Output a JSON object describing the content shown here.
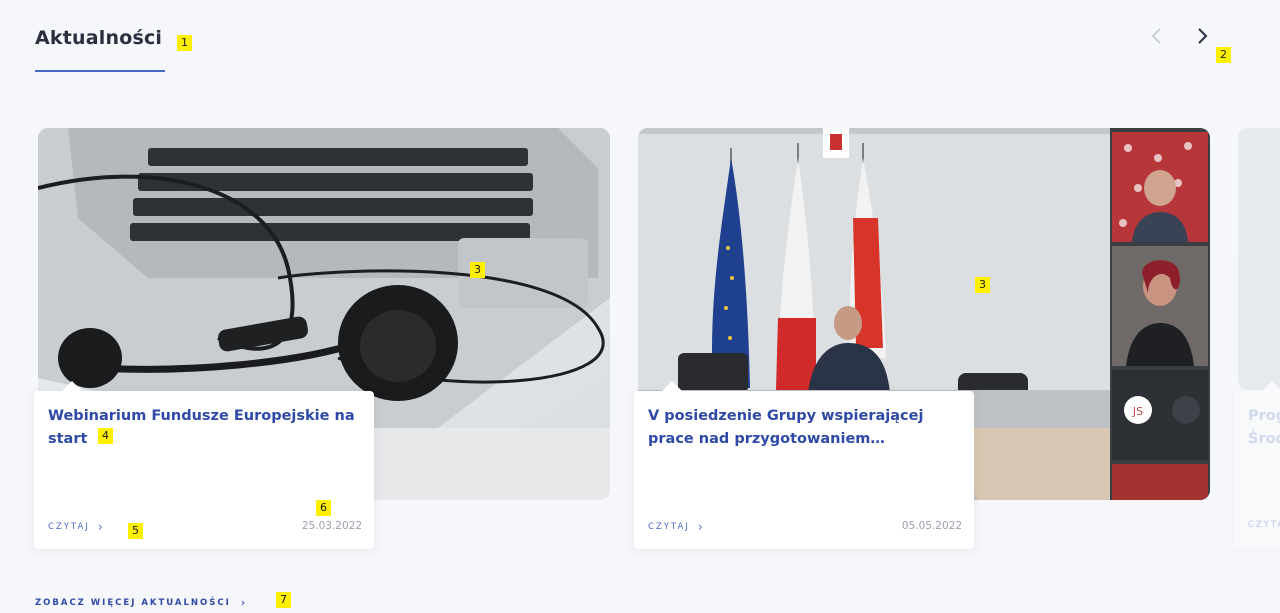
{
  "section": {
    "title": "Aktualności",
    "see_more_label": "ZOBACZ WIĘCEJ AKTUALNOŚCI"
  },
  "carousel": {
    "prev_icon": "chevron-left-icon",
    "next_icon": "chevron-right-icon"
  },
  "markers": {
    "m1": "1",
    "m2": "2",
    "m3a": "3",
    "m3b": "3",
    "m4": "4",
    "m5": "5",
    "m6": "6",
    "m7": "7"
  },
  "cards": [
    {
      "title": "Webinarium Fundusze Europejskie na start",
      "read_label": "CZYTAJ",
      "date": "25.03.2022"
    },
    {
      "title": "V posiedzenie Grupy wspierającej prace nad przygotowaniem…",
      "read_label": "CZYTAJ",
      "date": "05.05.2022"
    },
    {
      "title": "Prog Środ",
      "read_label": "CZYTAJ",
      "date": ""
    }
  ],
  "video_tiles": {
    "initials": "JS"
  },
  "colors": {
    "accent": "#2e49a8",
    "link": "#4b68c8",
    "background": "#f5f7fa"
  }
}
